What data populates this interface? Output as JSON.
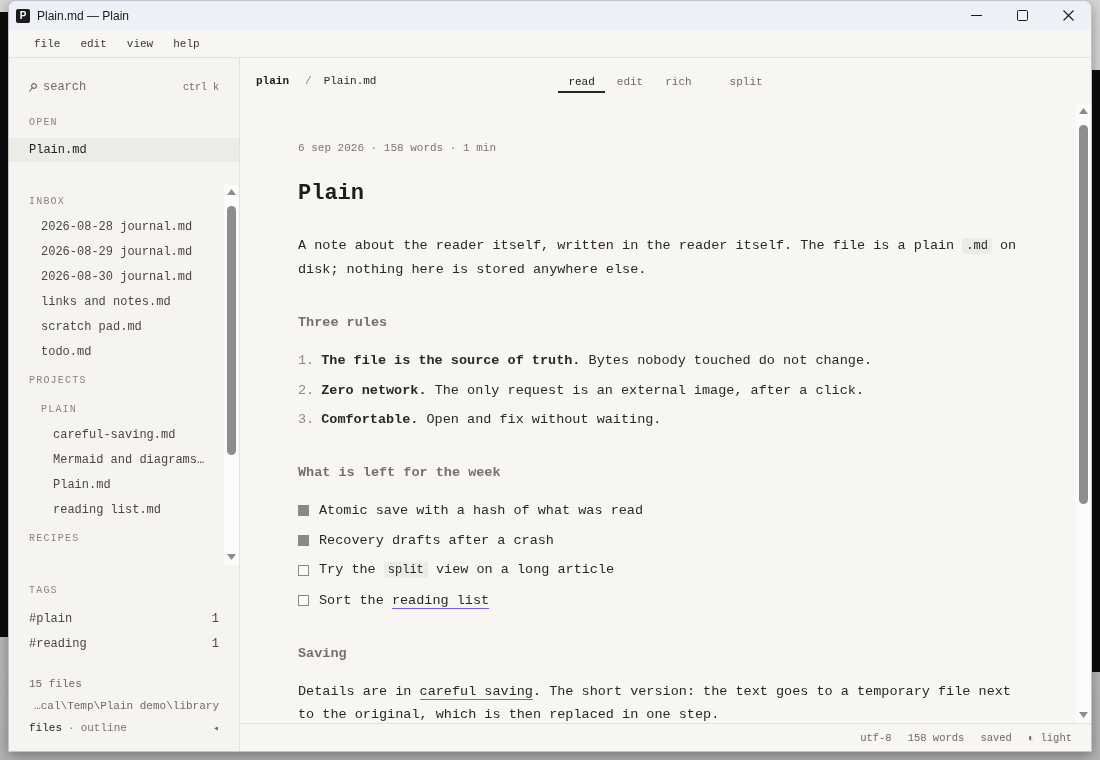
{
  "window": {
    "app_icon": "P",
    "title": "Plain.md — Plain"
  },
  "menu": [
    "file",
    "edit",
    "view",
    "help"
  ],
  "sidebar": {
    "search": {
      "placeholder": "search",
      "shortcut": "ctrl k"
    },
    "open": {
      "label": "OPEN",
      "items": [
        {
          "name": "Plain.md",
          "selected": true
        }
      ]
    },
    "tree": [
      {
        "kind": "folder",
        "label": "INBOX",
        "children": [
          {
            "kind": "file",
            "label": "2026-08-28 journal.md"
          },
          {
            "kind": "file",
            "label": "2026-08-29 journal.md"
          },
          {
            "kind": "file",
            "label": "2026-08-30 journal.md"
          },
          {
            "kind": "file",
            "label": "links and notes.md"
          },
          {
            "kind": "file",
            "label": "scratch pad.md"
          },
          {
            "kind": "file",
            "label": "todo.md"
          }
        ]
      },
      {
        "kind": "folder",
        "label": "PROJECTS",
        "children": [
          {
            "kind": "folder",
            "label": "PLAIN",
            "children": [
              {
                "kind": "file",
                "label": "careful-saving.md"
              },
              {
                "kind": "file",
                "label": "Mermaid and diagrams…"
              },
              {
                "kind": "file",
                "label": "Plain.md"
              },
              {
                "kind": "file",
                "label": "reading list.md"
              }
            ]
          }
        ]
      },
      {
        "kind": "folder",
        "label": "RECIPES"
      }
    ],
    "tags": {
      "label": "TAGS",
      "items": [
        {
          "name": "#plain",
          "count": "1"
        },
        {
          "name": "#reading",
          "count": "1"
        }
      ]
    },
    "footer": {
      "file_count": "15 files",
      "path": "…cal\\Temp\\Plain demo\\library",
      "views": [
        {
          "label": "files",
          "selected": true
        },
        {
          "label": "outline",
          "selected": false
        }
      ],
      "separator": "·",
      "collapse": "◂"
    }
  },
  "header": {
    "breadcrumb": {
      "root": "plain",
      "separator": "/",
      "current": "Plain.md"
    },
    "tabs": [
      {
        "label": "read",
        "kind": "view",
        "selected": true
      },
      {
        "label": "edit",
        "kind": "view",
        "selected": false
      },
      {
        "label": "rich",
        "kind": "view",
        "selected": false
      },
      {
        "label": "split",
        "kind": "layout",
        "selected": false
      }
    ]
  },
  "document": {
    "meta": "6 sep 2026 · 158 words · 1 min",
    "blocks": [
      {
        "kind": "heading1",
        "text": "Plain"
      },
      {
        "kind": "paragraph",
        "spans": [
          {
            "kind": "text",
            "text": "A note about the reader itself, written in the reader itself. The file is a plain "
          },
          {
            "kind": "code",
            "text": ".md"
          },
          {
            "kind": "text",
            "text": " on disk; nothing here is stored anywhere else."
          }
        ]
      },
      {
        "kind": "heading2",
        "text": "Three rules"
      },
      {
        "kind": "ordered_list",
        "items": [
          {
            "number": "1.",
            "text": "**The file is the source of truth.** Bytes nobody touched do not change."
          },
          {
            "number": "2.",
            "text": "**Zero network.** The only request is an external image, after a click."
          },
          {
            "number": "3.",
            "text": "**Comfortable.** Open and fix without waiting."
          }
        ]
      },
      {
        "kind": "heading2",
        "text": "What is left for the week"
      },
      {
        "kind": "task_list",
        "items": [
          {
            "checked": true,
            "spans": [
              {
                "kind": "text",
                "text": "Atomic save with a hash of what was read"
              }
            ]
          },
          {
            "checked": true,
            "spans": [
              {
                "kind": "text",
                "text": "Recovery drafts after a crash"
              }
            ]
          },
          {
            "checked": false,
            "spans": [
              {
                "kind": "text",
                "text": "Try the "
              },
              {
                "kind": "code",
                "text": "split"
              },
              {
                "kind": "text",
                "text": " view on a long article"
              }
            ]
          },
          {
            "checked": false,
            "spans": [
              {
                "kind": "text",
                "text": "Sort the "
              },
              {
                "kind": "link",
                "text": "reading list"
              }
            ]
          }
        ]
      },
      {
        "kind": "heading2",
        "text": "Saving"
      },
      {
        "kind": "paragraph",
        "spans": [
          {
            "kind": "text",
            "text": "Details are in "
          },
          {
            "kind": "link",
            "text": "careful saving"
          },
          {
            "kind": "text",
            "text": ". The short version: the text goes to a temporary file next to the original, which is then replaced in one step."
          }
        ]
      }
    ]
  },
  "status_bar": {
    "items": [
      "utf-8",
      "158 words",
      "saved"
    ],
    "theme": "◐ light"
  }
}
